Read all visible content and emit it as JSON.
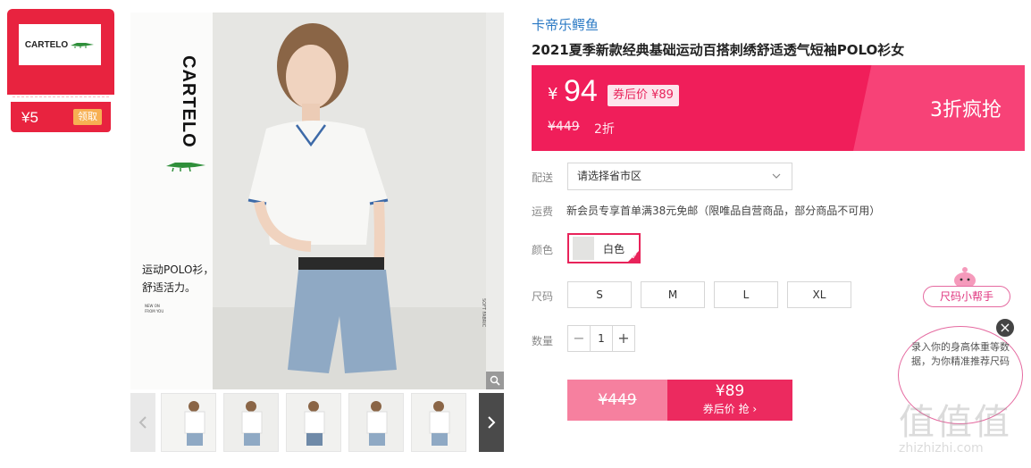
{
  "coupon": {
    "logo_text": "CARTELO",
    "amount": "¥5",
    "claim_label": "领取"
  },
  "main_image": {
    "brand_vertical": "CARTELO",
    "slogan_line1": "运动POLO衫，",
    "slogan_line2": "舒适活力。",
    "tiny_line1": "NEW ON",
    "tiny_line2": "FROM YOU"
  },
  "product": {
    "brand": "卡帝乐鳄鱼",
    "title": "2021夏季新款经典基础运动百搭刺绣舒适透气短袖POLO衫女"
  },
  "price_banner": {
    "currency": "¥",
    "price": "94",
    "after_coupon": "券后价 ¥89",
    "original_price": "¥449",
    "discount": "2折",
    "flash_label": "3折疯抢"
  },
  "delivery": {
    "label": "配送",
    "placeholder": "请选择省市区"
  },
  "shipping": {
    "label": "运费",
    "text": "新会员专享首单满38元免邮（限唯品自营商品，部分商品不可用）"
  },
  "color": {
    "label": "颜色",
    "selected": "白色"
  },
  "size": {
    "label": "尺码",
    "options": [
      "S",
      "M",
      "L",
      "XL"
    ]
  },
  "quantity": {
    "label": "数量",
    "value": "1",
    "minus": "−",
    "plus": "+"
  },
  "buy": {
    "original_price": "¥449",
    "coupon_price": "¥89",
    "coupon_label": "券后价 抢 ›"
  },
  "size_helper": {
    "tag": "尺码小帮手",
    "text": "录入你的身高体重等数据，为你精准推荐尺码",
    "close": "×"
  },
  "watermark": {
    "big": "值值值",
    "small": "zhizhizhi.com"
  },
  "colors": {
    "accent": "#f01e5a",
    "brand_link": "#2a79c4",
    "coupon_red": "#e8233f"
  }
}
